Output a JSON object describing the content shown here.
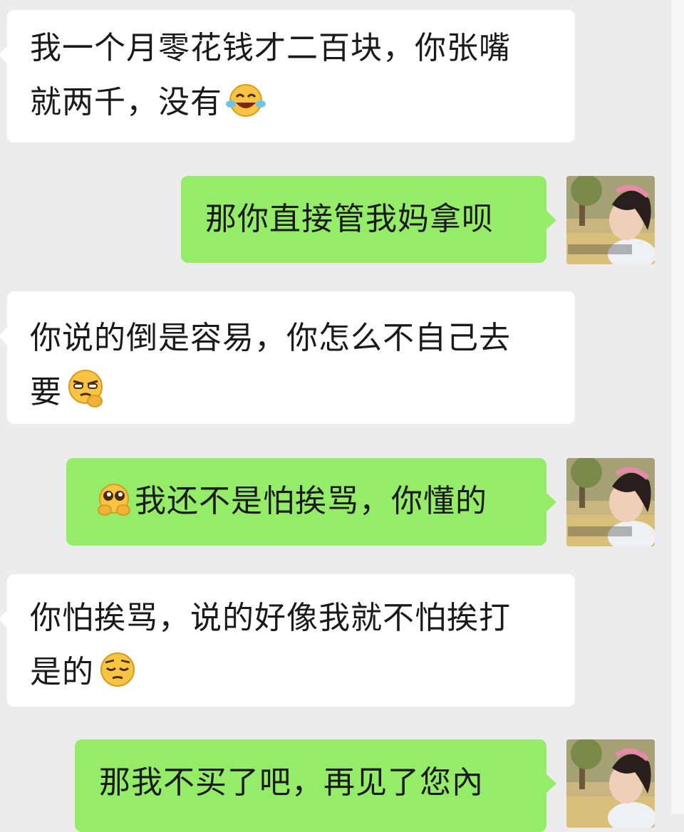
{
  "chat": {
    "messages": [
      {
        "side": "in",
        "lines": [
          "我一个月零花钱才二百块，你张嘴",
          "就两千，没有"
        ],
        "emoji": "laughing-tears-emoji"
      },
      {
        "side": "out",
        "text": "那你直接管我妈拿呗",
        "avatar": "girl-profile-avatar"
      },
      {
        "side": "in",
        "lines": [
          "你说的倒是容易，你怎么不自己去",
          "要"
        ],
        "emoji": "smirk-thinking-emoji"
      },
      {
        "side": "out",
        "text": "我还不是怕挨骂，你懂的",
        "emoji": "pleading-hands-emoji",
        "avatar": "girl-profile-avatar"
      },
      {
        "side": "in",
        "lines": [
          "你怕挨骂，说的好像我就不怕挨打",
          "是的"
        ],
        "emoji": "pensive-emoji"
      },
      {
        "side": "out",
        "text": "那我不买了吧，再见了您內",
        "avatar": "girl-profile-avatar"
      }
    ],
    "colors": {
      "background": "#ececec",
      "incoming_bubble": "#ffffff",
      "outgoing_bubble": "#95ec69",
      "text": "#1a1a1a"
    }
  }
}
